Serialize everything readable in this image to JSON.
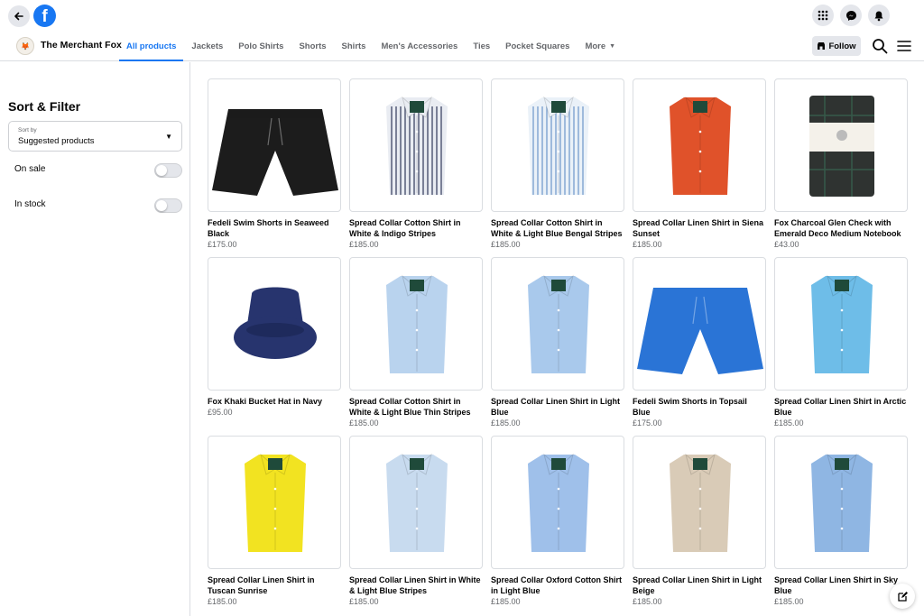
{
  "app": {
    "brand_letter": "f"
  },
  "shop": {
    "name": "The Merchant Fox",
    "tabs": [
      {
        "label": "All products",
        "active": true
      },
      {
        "label": "Jackets"
      },
      {
        "label": "Polo Shirts"
      },
      {
        "label": "Shorts"
      },
      {
        "label": "Shirts"
      },
      {
        "label": "Men's Accessories"
      },
      {
        "label": "Ties"
      },
      {
        "label": "Pocket Squares"
      },
      {
        "label": "More"
      }
    ],
    "follow_label": "Follow"
  },
  "sidebar": {
    "title": "Sort & Filter",
    "sort": {
      "label": "Sort by",
      "value": "Suggested products"
    },
    "filters": [
      {
        "label": "On sale",
        "enabled": false
      },
      {
        "label": "In stock",
        "enabled": false
      }
    ]
  },
  "products": [
    {
      "title": "Fedeli Swim Shorts in Seaweed Black",
      "price": "£175.00",
      "kind": "shorts",
      "color": "#1c1c1c"
    },
    {
      "title": "Spread Collar Cotton Shirt in White & Indigo Stripes",
      "price": "£185.00",
      "kind": "shirt-stripes",
      "color": "#e9ecf2",
      "stripe": "#4a5370"
    },
    {
      "title": "Spread Collar Cotton Shirt in White & Light Blue Bengal Stripes",
      "price": "£185.00",
      "kind": "shirt-stripes",
      "color": "#eaf1f8",
      "stripe": "#7ea3cf"
    },
    {
      "title": "Spread Collar Linen Shirt in Siena Sunset",
      "price": "£185.00",
      "kind": "shirt",
      "color": "#e0522a"
    },
    {
      "title": "Fox Charcoal Glen Check with Emerald Deco Medium Notebook",
      "price": "£43.00",
      "kind": "notebook",
      "color": "#2f3331"
    },
    {
      "title": "Fox Khaki Bucket Hat in Navy",
      "price": "£95.00",
      "kind": "hat",
      "color": "#27346e"
    },
    {
      "title": "Spread Collar Cotton Shirt in White & Light Blue Thin Stripes",
      "price": "£185.00",
      "kind": "shirt",
      "color": "#b9d3ee"
    },
    {
      "title": "Spread Collar Linen Shirt in Light Blue",
      "price": "£185.00",
      "kind": "shirt",
      "color": "#a9c9ec"
    },
    {
      "title": "Fedeli Swim Shorts in Topsail Blue",
      "price": "£175.00",
      "kind": "shorts",
      "color": "#2a74d6"
    },
    {
      "title": "Spread Collar Linen Shirt in Arctic Blue",
      "price": "£185.00",
      "kind": "shirt",
      "color": "#6ebde8"
    },
    {
      "title": "Spread Collar Linen Shirt in Tuscan Sunrise",
      "price": "£185.00",
      "kind": "shirt",
      "color": "#f2e321"
    },
    {
      "title": "Spread Collar Linen Shirt in White & Light Blue Stripes",
      "price": "£185.00",
      "kind": "shirt",
      "color": "#c8dbef"
    },
    {
      "title": "Spread Collar Oxford Cotton Shirt in Light Blue",
      "price": "£185.00",
      "kind": "shirt",
      "color": "#9fc0ea"
    },
    {
      "title": "Spread Collar Linen Shirt in Light Beige",
      "price": "£185.00",
      "kind": "shirt",
      "color": "#d9cbb7"
    },
    {
      "title": "Spread Collar Linen Shirt in Sky Blue",
      "price": "£185.00",
      "kind": "shirt",
      "color": "#8fb6e3"
    }
  ],
  "colors": {
    "accent": "#1877f2",
    "border": "#dadde1",
    "muted": "#65676b"
  },
  "icons": [
    "back-arrow-icon",
    "facebook-logo-icon",
    "apps-grid-icon",
    "messenger-icon",
    "notifications-bell-icon",
    "shop-icon",
    "search-icon",
    "menu-icon",
    "chevron-down-icon",
    "compose-icon"
  ]
}
